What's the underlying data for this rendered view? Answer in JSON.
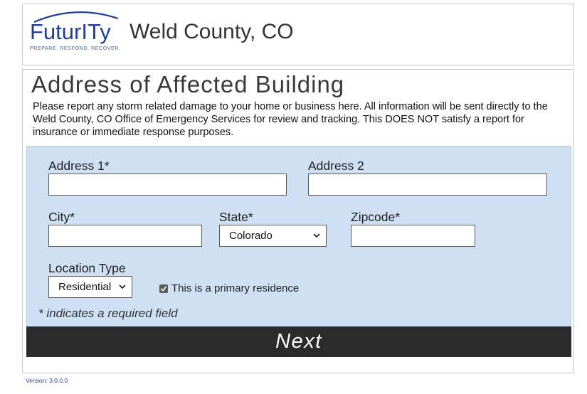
{
  "header": {
    "logo_text": "FuturITy",
    "logo_tagline": "PREPARE. RESPOND. RECOVER.",
    "county_title": "Weld County, CO"
  },
  "main": {
    "heading": "Address of Affected Building",
    "intro": "Please report any storm related damage to your home or business here. All information will be sent directly to the Weld County, CO Office of Emergency Services for review and tracking. This DOES NOT satisfy a report for insurance or immediate response purposes."
  },
  "form": {
    "address1_label": "Address 1*",
    "address1_value": "",
    "address2_label": "Address 2",
    "address2_value": "",
    "city_label": "City*",
    "city_value": "",
    "state_label": "State*",
    "state_value": "Colorado",
    "zip_label": "Zipcode*",
    "zip_value": "",
    "location_type_label": "Location Type",
    "location_type_value": "Residential",
    "primary_residence_label": "This is a primary residence",
    "primary_residence_checked": true,
    "required_note": "* indicates a required field",
    "next_label": "Next"
  },
  "footer": {
    "version": "Version: 3.0.0.0"
  },
  "colors": {
    "brand": "#1f3f9a",
    "form_panel": "#cfe0f5",
    "button": "#2b2b2b"
  },
  "icons": [
    "logo-arc-icon",
    "chevron-down-icon",
    "checkmark-icon"
  ]
}
